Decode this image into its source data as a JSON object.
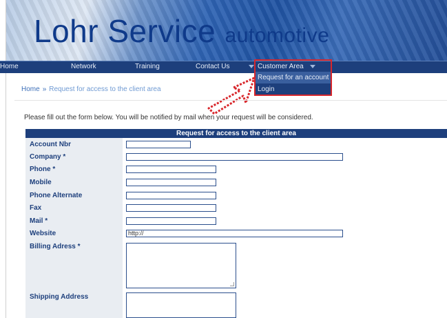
{
  "header": {
    "brand": "Lohr Service",
    "brand_sub": "automotive"
  },
  "nav": {
    "items": [
      {
        "label": "Home"
      },
      {
        "label": "Network"
      },
      {
        "label": "Training"
      },
      {
        "label": "Contact Us"
      },
      {
        "label": "Customer Area"
      }
    ],
    "dropdown": [
      {
        "label": "Request for an account"
      },
      {
        "label": "Login"
      }
    ]
  },
  "breadcrumb": {
    "home": "Home",
    "separator": "»",
    "current": "Request for access to the client area"
  },
  "intro": "Please fill out the form below. You will be notified by mail when your request will be considered.",
  "form": {
    "title": "Request for access to the client area",
    "fields": {
      "account_nbr": {
        "label": "Account Nbr",
        "value": ""
      },
      "company": {
        "label": "Company *",
        "value": ""
      },
      "phone": {
        "label": "Phone *",
        "value": ""
      },
      "mobile": {
        "label": "Mobile",
        "value": ""
      },
      "phone_alternate": {
        "label": "Phone Alternate",
        "value": ""
      },
      "fax": {
        "label": "Fax",
        "value": ""
      },
      "mail": {
        "label": "Mail *",
        "value": ""
      },
      "website": {
        "label": "Website",
        "value": "http://"
      },
      "billing_address": {
        "label": "Billing Adress *",
        "value": ""
      },
      "shipping_address": {
        "label": "Shipping Address",
        "value": ""
      }
    }
  },
  "colors": {
    "nav_bg": "#1d3f7c",
    "highlight": "#d8262b",
    "link": "#3d6fb8"
  }
}
